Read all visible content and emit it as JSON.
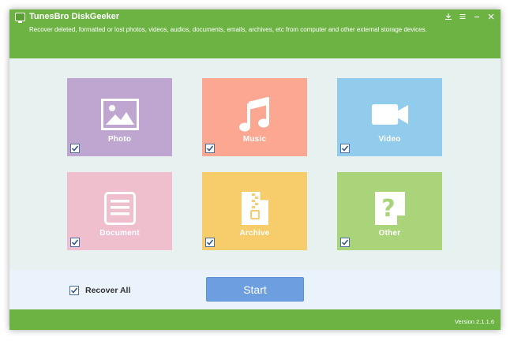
{
  "app": {
    "title": "TunesBro DiskGeeker",
    "subtitle": "Recover deleted, formatted or lost photos, videos, audios, documents, emails, archives, etc from computer and other external storage devices."
  },
  "window_controls": {
    "icons": [
      "download-icon",
      "menu-icon",
      "minimize-icon",
      "close-icon"
    ]
  },
  "categories": [
    {
      "label": "Photo",
      "checked": true,
      "color": "#bfa6d1",
      "icon": "image-icon"
    },
    {
      "label": "Music",
      "checked": true,
      "color": "#fba792",
      "icon": "music-note-icon"
    },
    {
      "label": "Video",
      "checked": true,
      "color": "#92ccec",
      "icon": "video-camera-icon"
    },
    {
      "label": "Document",
      "checked": true,
      "color": "#efbfce",
      "icon": "document-icon"
    },
    {
      "label": "Archive",
      "checked": true,
      "color": "#f7cc6a",
      "icon": "archive-zip-icon"
    },
    {
      "label": "Other",
      "checked": true,
      "color": "#a9d479",
      "icon": "question-file-icon"
    }
  ],
  "footer": {
    "recover_all_label": "Recover All",
    "recover_all_checked": true,
    "start_label": "Start"
  },
  "status": {
    "version": "Version 2.1.1.6"
  },
  "colors": {
    "header": "#6db344",
    "body": "#e7f1ef",
    "footer_bar": "#eaf3fc",
    "start_button": "#6c9ee0"
  }
}
